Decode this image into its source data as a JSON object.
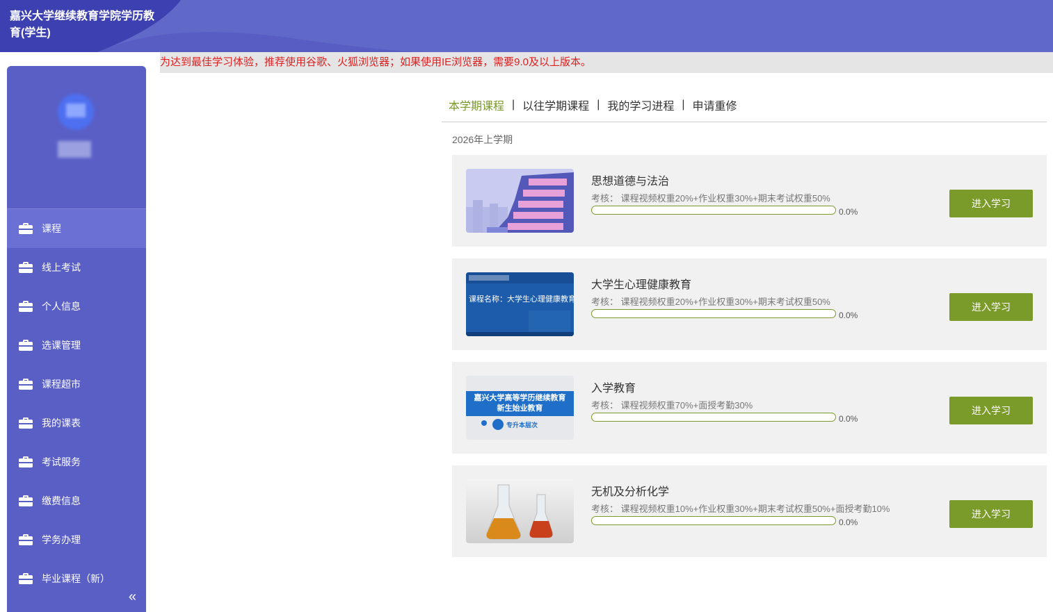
{
  "header": {
    "title": "嘉兴大学继续教育学院学历教育(学生)"
  },
  "notice": "为达到最佳学习体验，推荐使用谷歌、火狐浏览器；如果使用IE浏览器，需要9.0及以上版本。",
  "sidebar": {
    "items": [
      {
        "label": "课程",
        "active": true
      },
      {
        "label": "线上考试"
      },
      {
        "label": "个人信息"
      },
      {
        "label": "选课管理"
      },
      {
        "label": "课程超市"
      },
      {
        "label": "我的课表"
      },
      {
        "label": "考试服务"
      },
      {
        "label": "缴费信息"
      },
      {
        "label": "学务办理"
      },
      {
        "label": "毕业课程（新）"
      }
    ],
    "collapse_label": "«"
  },
  "tabs": [
    {
      "label": "本学期课程",
      "active": true
    },
    {
      "label": "以往学期课程"
    },
    {
      "label": "我的学习进程"
    },
    {
      "label": "申请重修"
    }
  ],
  "tab_separator": "|",
  "semester": "2026年上学期",
  "courses": [
    {
      "title": "思想道德与法治",
      "assess": "考核： 课程视频权重20%+作业权重30%+期末考试权重50%",
      "progress": 0.0,
      "progress_text": "0.0%",
      "button": "进入学习"
    },
    {
      "title": "大学生心理健康教育",
      "assess": "考核： 课程视频权重20%+作业权重30%+期末考试权重50%",
      "progress": 0.0,
      "progress_text": "0.0%",
      "button": "进入学习",
      "thumb_title": "课程名称：大学生心理健康教育"
    },
    {
      "title": "入学教育",
      "assess": "考核： 课程视频权重70%+面授考勤30%",
      "progress": 0.0,
      "progress_text": "0.0%",
      "button": "进入学习",
      "thumb_title": "嘉兴大学高等学历继续教育",
      "thumb_subtitle": "新生始业教育",
      "thumb_tag": "专升本层次"
    },
    {
      "title": "无机及分析化学",
      "assess": "考核： 课程视频权重10%+作业权重30%+期末考试权重50%+面授考勤10%",
      "progress": 0.0,
      "progress_text": "0.0%",
      "button": "进入学习"
    }
  ],
  "colors": {
    "accent": "#7a9a2a",
    "sidebar": "#5a5fc6",
    "notice": "#e02020"
  }
}
